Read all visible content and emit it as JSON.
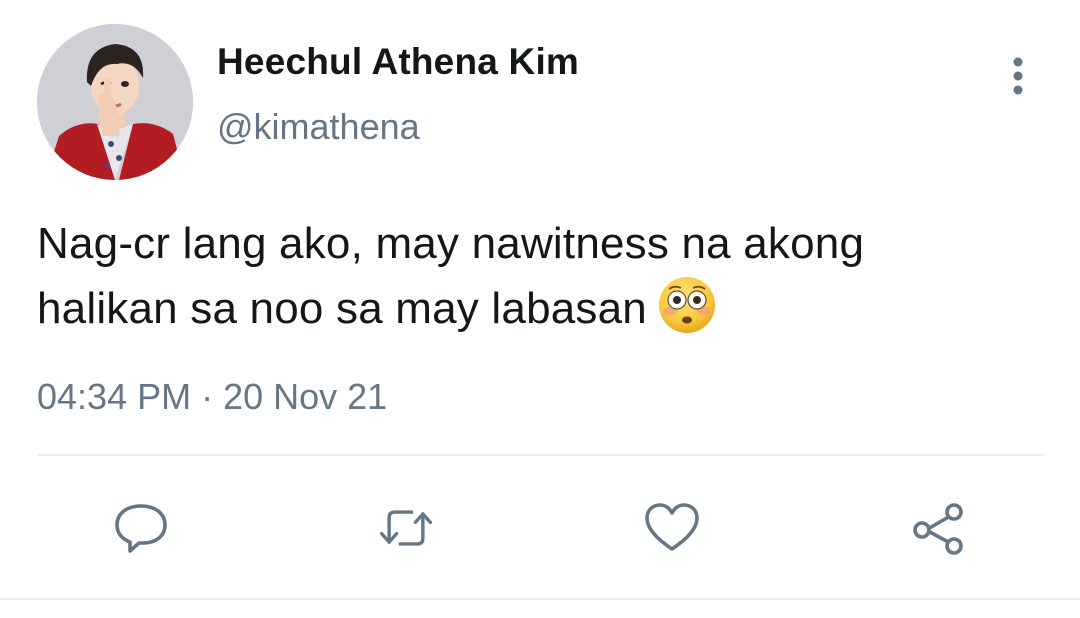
{
  "user": {
    "display_name": "Heechul Athena Kim",
    "handle": "@kimathena"
  },
  "tweet": {
    "text_line1": "Nag-cr lang ako, may nawitness na akong",
    "text_line2": "halikan sa noo sa may labasan",
    "emoji": "flushed-face",
    "timestamp": "04:34 PM · 20 Nov 21"
  },
  "actions": {
    "reply": "reply-icon",
    "retweet": "retweet-icon",
    "like": "heart-icon",
    "share": "share-icon"
  },
  "colors": {
    "text_primary": "#14171a",
    "text_secondary": "#657786",
    "icon": "#657786",
    "divider": "#e6ecf0"
  }
}
